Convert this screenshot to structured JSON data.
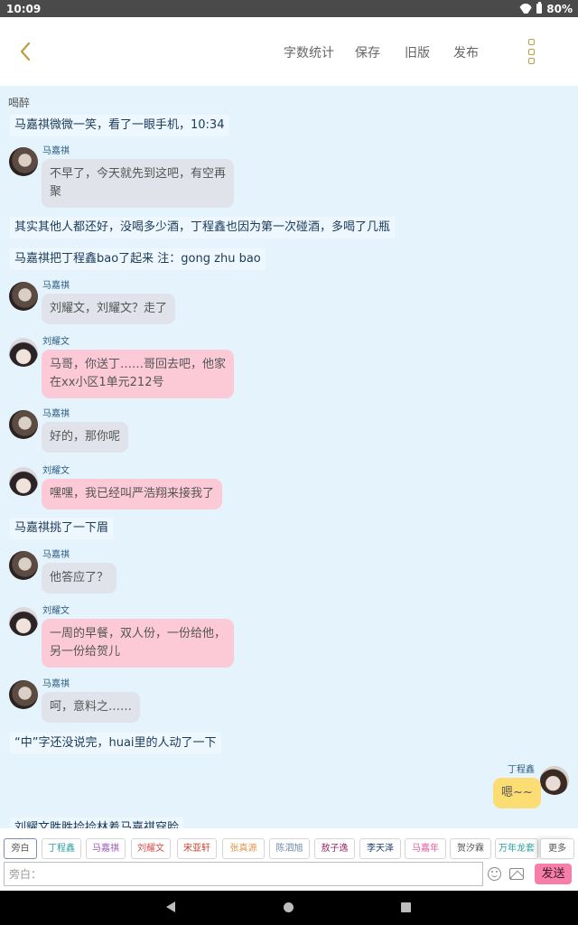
{
  "status_bar": {
    "time": "10:09",
    "battery": "80%"
  },
  "header": {
    "buttons": [
      "字数统计",
      "保存",
      "旧版",
      "发布"
    ]
  },
  "chat": {
    "label": "喝醉",
    "messages": [
      {
        "type": "narration",
        "text": "马嘉祺微微一笑，看了一眼手机，10:34"
      },
      {
        "type": "left",
        "speaker": "马嘉祺",
        "avatar": "ma",
        "color": "grey",
        "lines": [
          "不早了，今天就先到这吧，有空再",
          "聚"
        ]
      },
      {
        "type": "narration",
        "text": "其实其他人都还好，没喝多少酒，丁程鑫也因为第一次碰酒，多喝了几瓶"
      },
      {
        "type": "narration",
        "text": "马嘉祺把丁程鑫bao了起来 注：gong zhu bao"
      },
      {
        "type": "left",
        "speaker": "马嘉祺",
        "avatar": "ma",
        "color": "grey",
        "lines": [
          "刘耀文，刘耀文？走了"
        ]
      },
      {
        "type": "left",
        "speaker": "刘耀文",
        "avatar": "liu",
        "color": "pink",
        "lines": [
          "马哥，你送丁……哥回去吧，他家",
          "在xx小区1单元212号"
        ]
      },
      {
        "type": "left",
        "speaker": "马嘉祺",
        "avatar": "ma",
        "color": "grey",
        "lines": [
          "好的，那你呢"
        ]
      },
      {
        "type": "left",
        "speaker": "刘耀文",
        "avatar": "liu",
        "color": "pink",
        "lines": [
          "嘿嘿，我已经叫严浩翔来接我了"
        ]
      },
      {
        "type": "narration",
        "text": "马嘉祺挑了一下眉"
      },
      {
        "type": "left",
        "speaker": "马嘉祺",
        "avatar": "ma",
        "color": "grey",
        "lines": [
          "他答应了？"
        ]
      },
      {
        "type": "left",
        "speaker": "刘耀文",
        "avatar": "liu",
        "color": "pink",
        "lines": [
          "一周的早餐，双人份，一份给他，",
          "另一份给贺儿"
        ]
      },
      {
        "type": "left",
        "speaker": "马嘉祺",
        "avatar": "ma",
        "color": "grey",
        "lines": [
          "呵，意料之……"
        ]
      },
      {
        "type": "narration",
        "text": "“中”字还没说完，huai里的人动了一下"
      },
      {
        "type": "right",
        "speaker": "丁程鑫",
        "avatar": "ding",
        "color": "yellow",
        "lines": [
          "嗯~~"
        ]
      },
      {
        "type": "narration",
        "text": "刘耀文胜胜捡捡林着马嘉祺穿脸"
      }
    ]
  },
  "quick_select": [
    {
      "label": "旁白",
      "color": "#555555"
    },
    {
      "label": "丁程鑫",
      "color": "#2a9d9d"
    },
    {
      "label": "马嘉祺",
      "color": "#9a5ab8"
    },
    {
      "label": "刘耀文",
      "color": "#d84a4a"
    },
    {
      "label": "宋亚轩",
      "color": "#c2402a"
    },
    {
      "label": "张真源",
      "color": "#e0964a"
    },
    {
      "label": "陈泗旭",
      "color": "#6a8aa8"
    },
    {
      "label": "敖子逸",
      "color": "#9a2a6a"
    },
    {
      "label": "李天泽",
      "color": "#1a3a6a"
    },
    {
      "label": "马嘉年",
      "color": "#e05aa0"
    },
    {
      "label": "贺汐霖",
      "color": "#555555"
    },
    {
      "label": "万年龙套",
      "color": "#2a9d9d"
    },
    {
      "label": "更多",
      "color": "#555555"
    }
  ],
  "input": {
    "placeholder": "旁白："
  },
  "send_label": "发送"
}
